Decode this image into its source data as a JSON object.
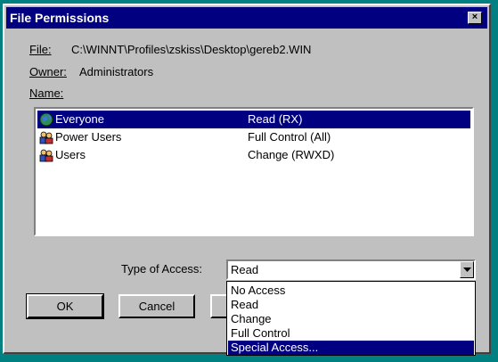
{
  "window": {
    "title": "File Permissions",
    "close_glyph": "×"
  },
  "fields": {
    "file_label": "File:",
    "file_value": "C:\\WINNT\\Profiles\\zskiss\\Desktop\\gereb2.WIN",
    "owner_label": "Owner:",
    "owner_value": "Administrators",
    "name_label": "Name:"
  },
  "permissions": [
    {
      "name": "Everyone",
      "access": "Read  (RX)",
      "icon": "globe-icon",
      "selected": true
    },
    {
      "name": "Power Users",
      "access": "Full Control  (All)",
      "icon": "group-icon",
      "selected": false
    },
    {
      "name": "Users",
      "access": "Change  (RWXD)",
      "icon": "group-icon",
      "selected": false
    }
  ],
  "type_of_access": {
    "label": "Type of Access:",
    "value": "Read",
    "options": [
      "No Access",
      "Read",
      "Change",
      "Full Control",
      "Special Access..."
    ],
    "highlighted_option": "Special Access..."
  },
  "buttons": {
    "ok": "OK",
    "cancel": "Cancel"
  },
  "colors": {
    "desktop": "#008080",
    "titlebar": "#000080",
    "selection": "#000080",
    "face": "#c0c0c0"
  }
}
